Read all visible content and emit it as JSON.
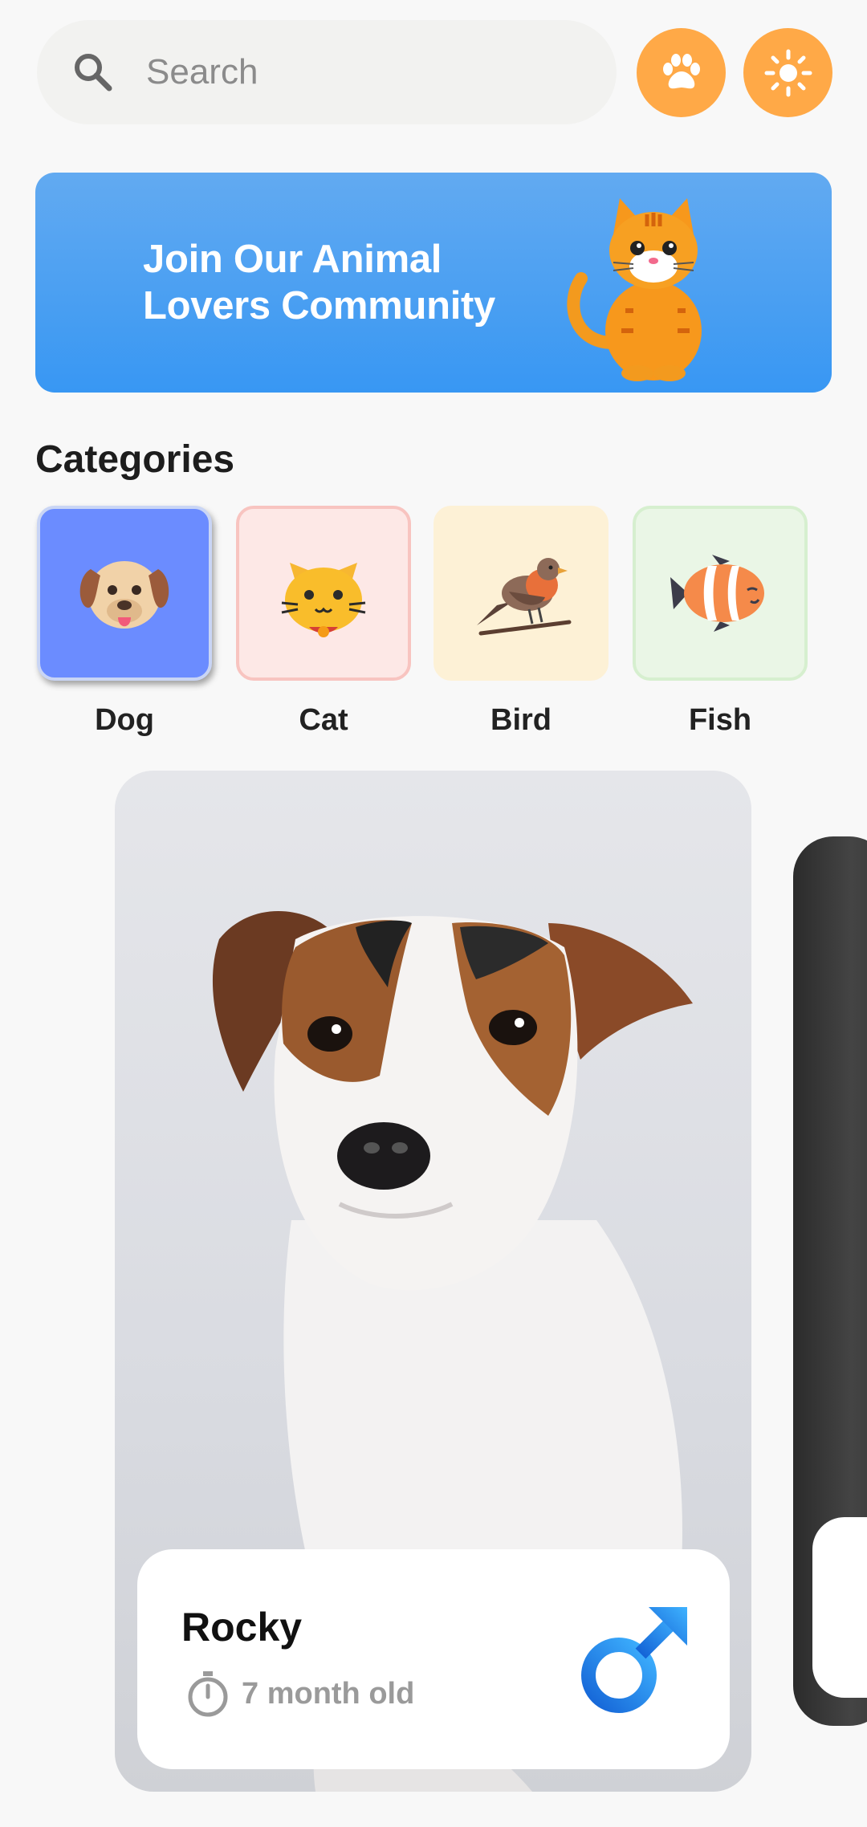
{
  "search": {
    "placeholder": "Search"
  },
  "header_buttons": [
    {
      "icon": "paw-icon"
    },
    {
      "icon": "sun-icon"
    }
  ],
  "banner": {
    "line1": "Join Our Animal",
    "line2": "Lovers Community"
  },
  "categories": {
    "title": "Categories",
    "items": [
      {
        "label": "Dog",
        "selected": true
      },
      {
        "label": "Cat"
      },
      {
        "label": "Bird"
      },
      {
        "label": "Fish"
      }
    ]
  },
  "pet": {
    "name": "Rocky",
    "age": "7 month old",
    "gender": "male"
  },
  "colors": {
    "accent": "#ffa947",
    "banner": "#3897f3",
    "selected_tile": "#6b8cff"
  }
}
